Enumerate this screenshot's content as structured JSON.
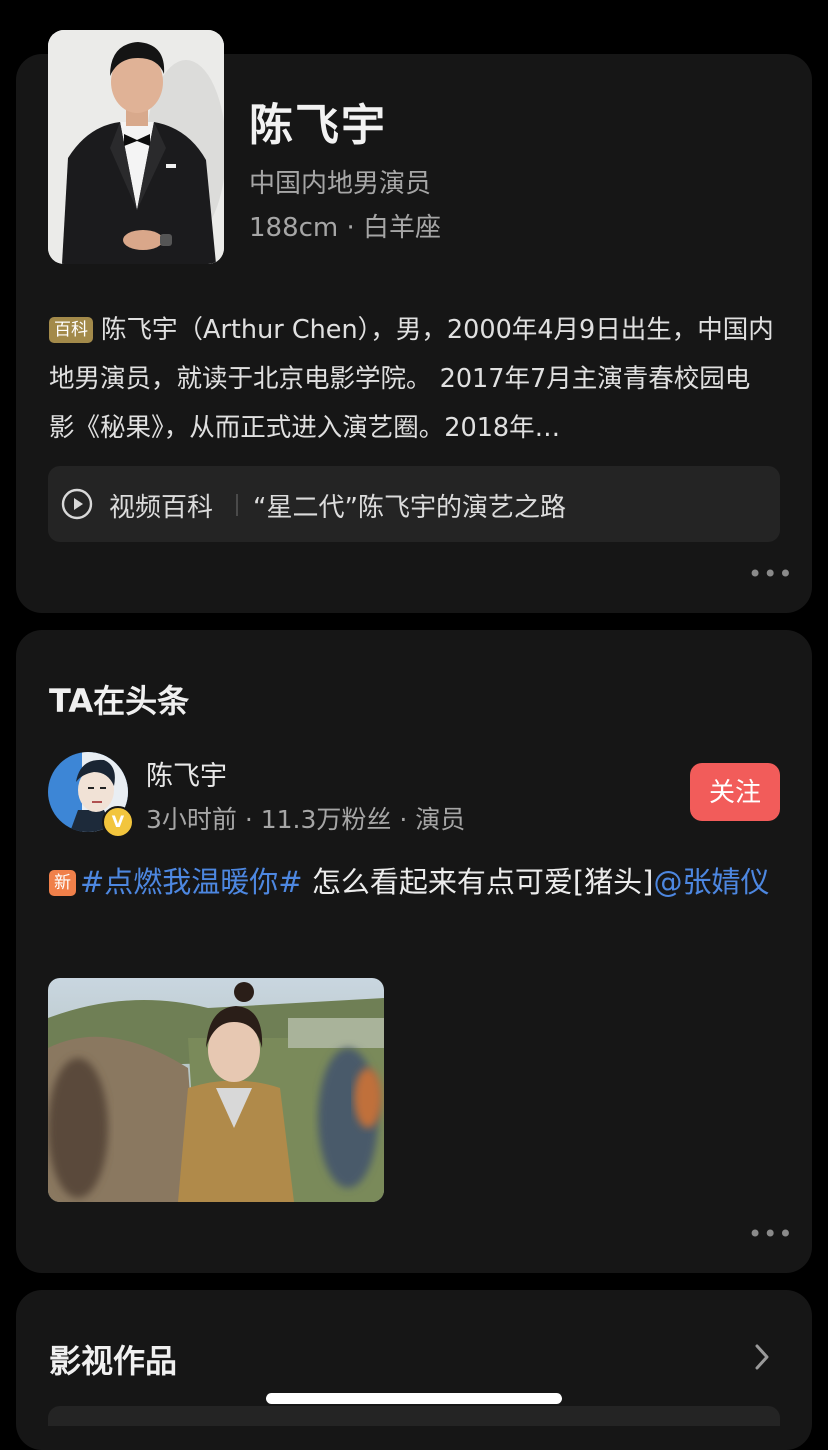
{
  "profile": {
    "name": "陈飞宇",
    "subtitle": "中国内地男演员",
    "meta": "188cm · 白羊座",
    "baike_tag": "百科",
    "bio": "陈飞宇（Arthur Chen），男，2000年4月9日出生，中国内地男演员，就读于北京电影学院。 2017年7月主演青春校园电影《秘果》，从而正式进入演艺圈。2018年…",
    "video_label": "视频百科",
    "video_title": "“星二代”陈飞宇的演艺之路",
    "more": "•••"
  },
  "headline": {
    "section_title": "TA在头条",
    "author_name": "陈飞宇",
    "author_meta": "3小时前 · 11.3万粉丝 · 演员",
    "verified_icon": "V",
    "follow_label": "关注",
    "new_tag": "新",
    "hashtag": "#点燃我温暖你#",
    "text": " 怎么看起来有点可爱[猪头]",
    "mention": "@张婧仪",
    "more": "•••"
  },
  "works": {
    "title": "影视作品"
  },
  "colors": {
    "background": "#000000",
    "card": "#161616",
    "follow_button": "#f25c5a",
    "link": "#4d87e0",
    "baike_tag": "#a38a4a",
    "new_tag": "#f0804a"
  }
}
